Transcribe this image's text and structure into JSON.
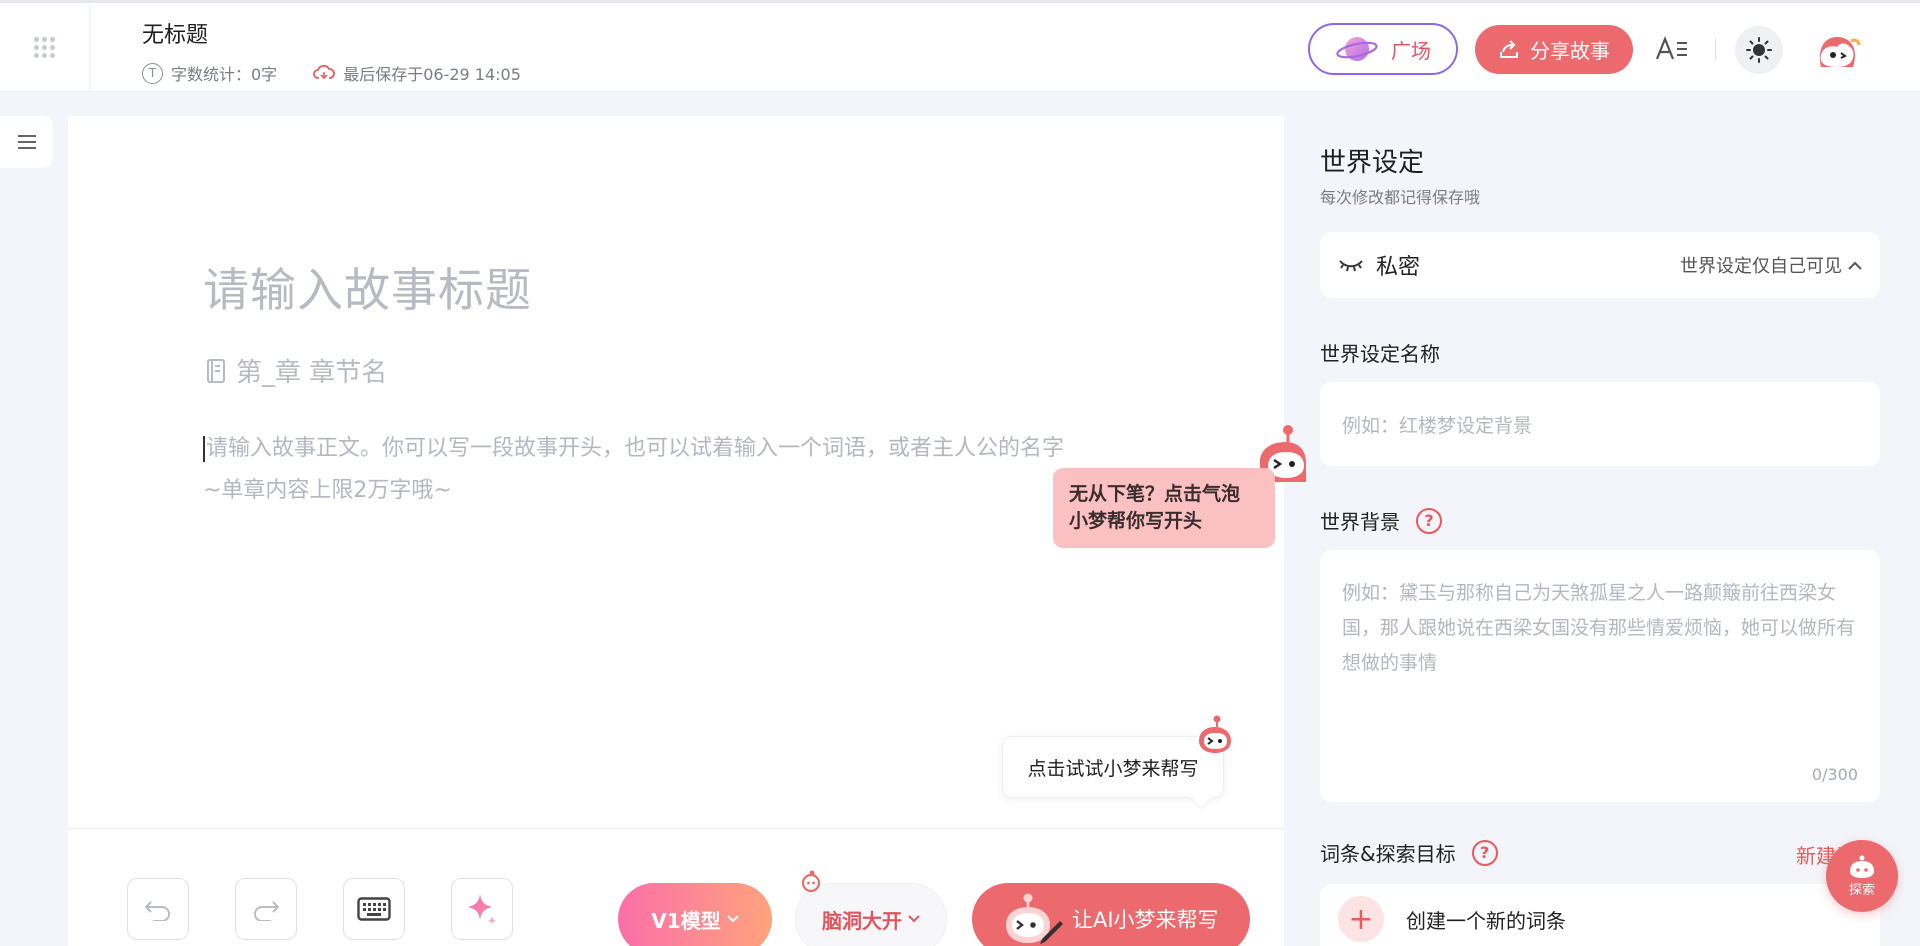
{
  "header": {
    "doc_title": "无标题",
    "word_count": "字数统计：0字",
    "last_saved": "最后保存于06-29 14:05",
    "plaza_label": "广场",
    "share_label": "分享故事"
  },
  "editor": {
    "title_placeholder": "请输入故事标题",
    "chapter_placeholder": "第_章 章节名",
    "body_placeholder_line1": "请输入故事正文。你可以写一段故事开头，也可以试着输入一个词语，或者主人公的名字",
    "body_placeholder_line2": "~单章内容上限2万字哦~",
    "bubble_line1": "无从下笔？点击气泡",
    "bubble_line2": "小梦帮你写开头",
    "hint_text": "点击试试小梦来帮写",
    "model_label": "V1模型",
    "mode_label": "脑洞大开",
    "ai_write_label": "让AI小梦来帮写"
  },
  "panel": {
    "title": "世界设定",
    "subtitle": "每次修改都记得保存哦",
    "privacy_label": "私密",
    "privacy_value": "世界设定仅自己可见",
    "name_label": "世界设定名称",
    "name_placeholder": "例如：红楼梦设定背景",
    "background_label": "世界背景",
    "background_placeholder": "例如：黛玉与那称自己为天煞孤星之人一路颠簸前往西梁女国，那人跟她说在西梁女国没有那些情爱烦恼，她可以做所有想做的事情",
    "background_counter": "0/300",
    "terms_label": "词条&探索目标",
    "new_link": "新建词",
    "create_term": "创建一个新的词条",
    "help_glyph": "?"
  },
  "fab": {
    "label": "探索"
  },
  "colors": {
    "accent": "#ec6a6e",
    "plaza_border": "#8d68e8",
    "bubble": "#fbc0c2",
    "model_gradient_start": "#fb6fa9",
    "model_gradient_end": "#fea37c"
  }
}
